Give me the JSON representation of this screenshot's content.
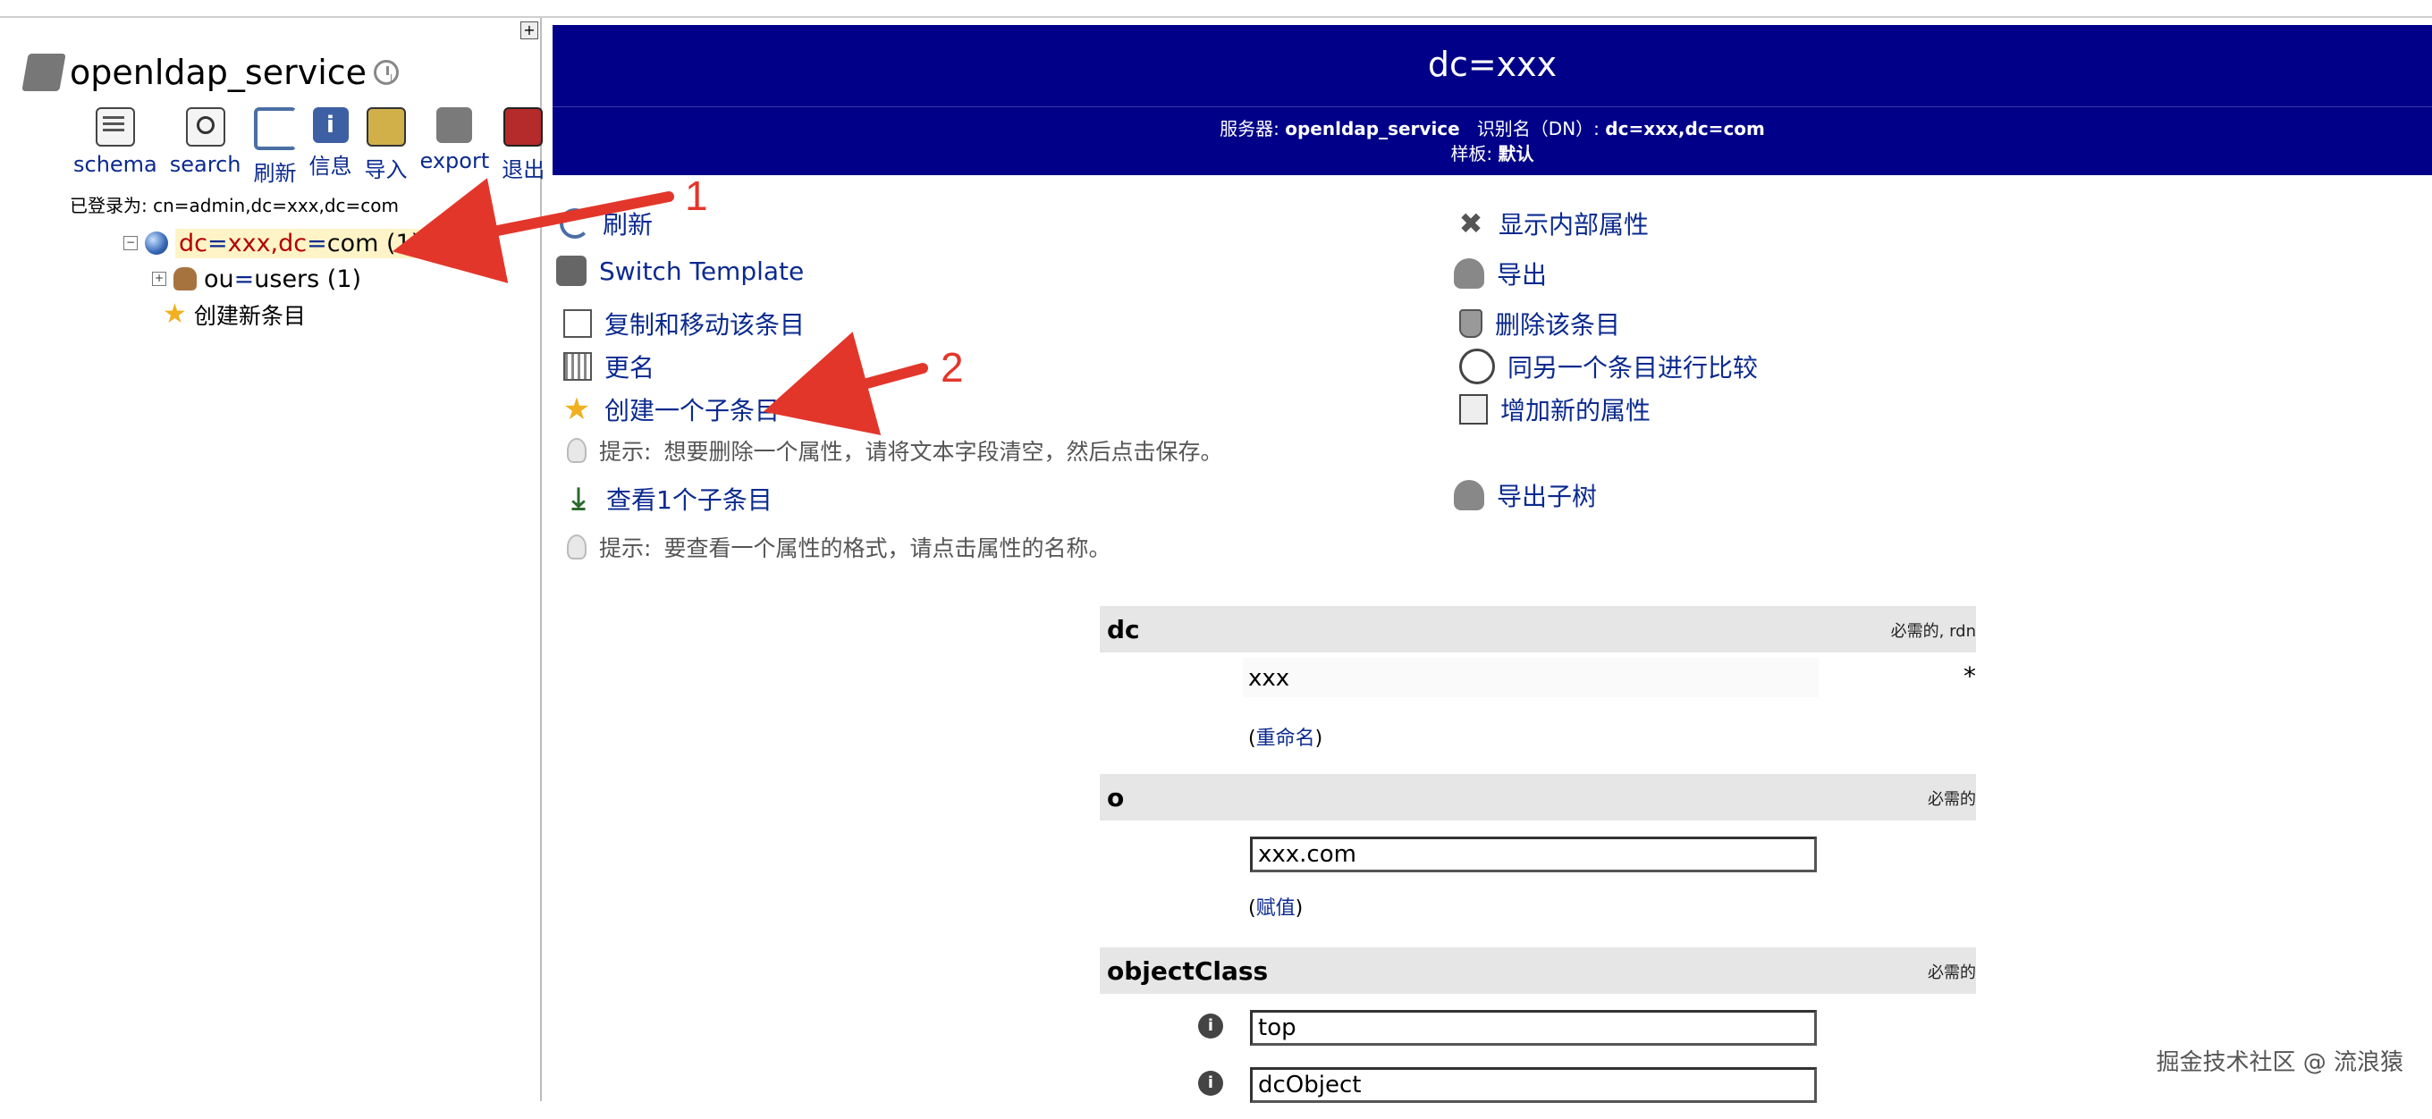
{
  "left": {
    "server_title": "openldap_service",
    "toolbar": [
      {
        "label": "schema",
        "icon": "schema-icon"
      },
      {
        "label": "search",
        "icon": "search-icon"
      },
      {
        "label": "刷新",
        "icon": "refresh-icon"
      },
      {
        "label": "信息",
        "icon": "info-icon"
      },
      {
        "label": "导入",
        "icon": "import-icon"
      },
      {
        "label": "export",
        "icon": "export-icon"
      },
      {
        "label": "退出",
        "icon": "logout-icon"
      }
    ],
    "logged_in_as": "已登录为: cn=admin,dc=xxx,dc=com",
    "tree": {
      "root_part1": "dc",
      "root_eq1": "=",
      "root_part2": "xxx,dc",
      "root_eq2": "=",
      "root_part3": "com (1)",
      "child_part1": "ou",
      "child_eq": "=",
      "child_part2": "users (1)",
      "new_entry": "创建新条目"
    }
  },
  "banner": {
    "title": "dc=xxx",
    "server_label": "服务器:",
    "server_value": "openldap_service",
    "dn_label": "识别名（DN）:",
    "dn_value": "dc=xxx,dc=com",
    "template_label": "样板:",
    "template_value": "默认"
  },
  "actions": {
    "refresh": "刷新",
    "switch_template": "Switch Template",
    "copy_move": "复制和移动该条目",
    "rename": "更名",
    "create_child": "创建一个子条目",
    "hint1_label": "提示:",
    "hint1_text": "想要删除一个属性，请将文本字段清空，然后点击保存。",
    "view_children": "查看1个子条目",
    "hint2_label": "提示:",
    "hint2_text": "要查看一个属性的格式，请点击属性的名称。",
    "show_internal": "显示内部属性",
    "export": "导出",
    "delete_entry": "删除该条目",
    "compare": "同另一个条目进行比较",
    "add_attr": "增加新的属性",
    "export_subtree": "导出子树"
  },
  "form": {
    "dc": {
      "name": "dc",
      "req": "必需的, rdn",
      "value": "xxx",
      "star": "*",
      "link": "重命名"
    },
    "o": {
      "name": "o",
      "req": "必需的",
      "value": "xxx.com",
      "link": "赋值"
    },
    "objectClass": {
      "name": "objectClass",
      "req": "必需的",
      "values": [
        "top",
        "dcObject"
      ]
    }
  },
  "annotations": {
    "n1": "1",
    "n2": "2"
  },
  "watermark": "掘金技术社区 @ 流浪猿",
  "colors": {
    "banner_bg": "#000088",
    "link": "#0b2a8f",
    "annotation": "#e3362b",
    "node_highlight": "#fff4c7"
  }
}
